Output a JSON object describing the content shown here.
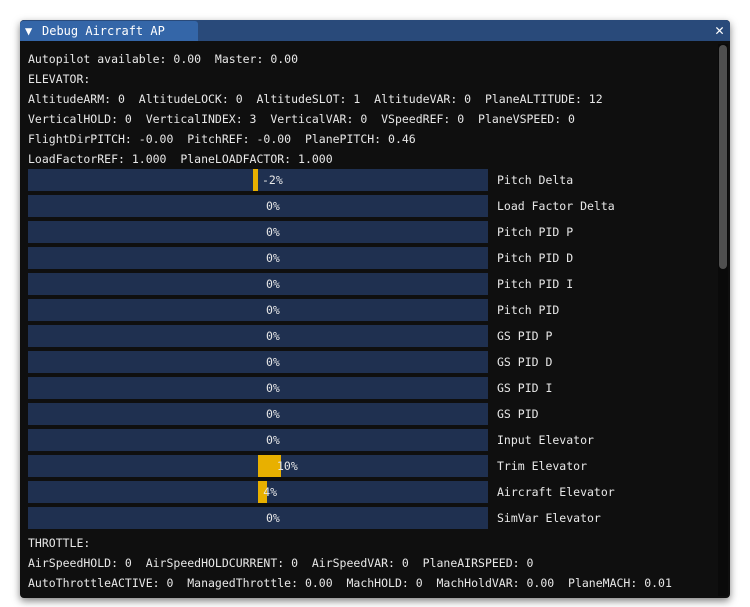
{
  "window": {
    "title": "Debug Aircraft AP",
    "collapse_icon": "triangle-down-icon",
    "close_icon": "close-icon"
  },
  "lines_top": [
    "Autopilot available: 0.00  Master: 0.00",
    "ELEVATOR:",
    "AltitudeARM: 0  AltitudeLOCK: 0  AltitudeSLOT: 1  AltitudeVAR: 0  PlaneALTITUDE: 12",
    "VerticalHOLD: 0  VerticalINDEX: 3  VerticalVAR: 0  VSpeedREF: 0  PlaneVSPEED: 0",
    "FlightDirPITCH: -0.00  PitchREF: -0.00  PlanePITCH: 0.46",
    "LoadFactorREF: 1.000  PlaneLOADFACTOR: 1.000"
  ],
  "bars": [
    {
      "label": "Pitch Delta",
      "value": -2,
      "text": "-2%"
    },
    {
      "label": "Load Factor Delta",
      "value": 0,
      "text": "0%"
    },
    {
      "label": "Pitch PID P",
      "value": 0,
      "text": "0%"
    },
    {
      "label": "Pitch PID D",
      "value": 0,
      "text": "0%"
    },
    {
      "label": "Pitch PID I",
      "value": 0,
      "text": "0%"
    },
    {
      "label": "Pitch PID",
      "value": 0,
      "text": "0%"
    },
    {
      "label": "GS PID P",
      "value": 0,
      "text": "0%"
    },
    {
      "label": "GS PID D",
      "value": 0,
      "text": "0%"
    },
    {
      "label": "GS PID I",
      "value": 0,
      "text": "0%"
    },
    {
      "label": "GS PID",
      "value": 0,
      "text": "0%"
    },
    {
      "label": "Input Elevator",
      "value": 0,
      "text": "0%"
    },
    {
      "label": "Trim Elevator",
      "value": 10,
      "text": "10%"
    },
    {
      "label": "Aircraft Elevator",
      "value": 4,
      "text": "4%"
    },
    {
      "label": "SimVar Elevator",
      "value": 0,
      "text": "0%"
    }
  ],
  "lines_bottom": [
    "THROTTLE:",
    "AirSpeedHOLD: 0  AirSpeedHOLDCURRENT: 0  AirSpeedVAR: 0  PlaneAIRSPEED: 0",
    "AutoThrottleACTIVE: 0  ManagedThrottle: 0.00  MachHOLD: 0  MachHoldVAR: 0.00  PlaneMACH: 0.01"
  ],
  "colors": {
    "bar_bg": "#1f3050",
    "bar_fill": "#e8b000",
    "title_bar": "#294a7a",
    "tab": "#3466a8"
  }
}
